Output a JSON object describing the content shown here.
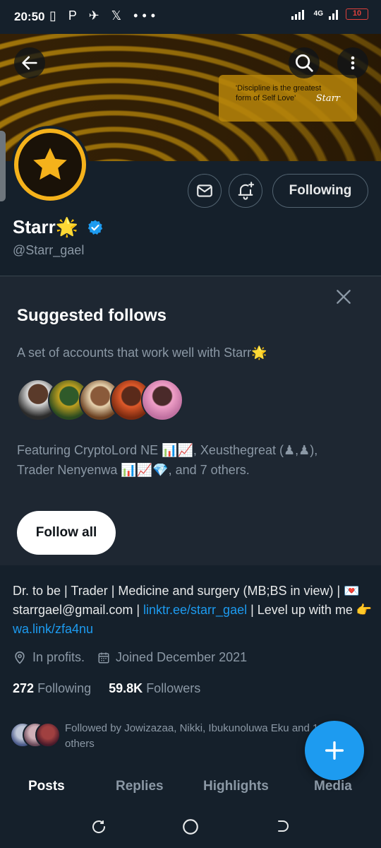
{
  "status_bar": {
    "time": "20:50",
    "notification_icons": "▯ P ✈ 𝕏 •••",
    "network": "4G",
    "battery": "10"
  },
  "banner": {
    "quote": "'Discipline is the greatest form of Self Love'",
    "signature": "Starr"
  },
  "header": {
    "back_icon": "arrow-left-icon",
    "search_icon": "search-icon",
    "more_icon": "more-vertical-icon"
  },
  "profile": {
    "name": "Starr🌟",
    "handle": "@Starr_gael",
    "following_button": "Following",
    "accent_color": "#1d9bf0"
  },
  "suggested": {
    "title": "Suggested follows",
    "subtitle": "A set of accounts that work well with Starr🌟",
    "featuring": "Featuring CryptoLord NE 📊📈, Xeusthegreat (♟,♟), Trader Nenyenwa 📊📈💎, and 7 others.",
    "follow_all": "Follow all"
  },
  "bio": {
    "text_1": "Dr. to be | Trader | Medicine and surgery (MB;BS in view) | 💌starrgael@gmail.com | ",
    "link_1": "linktr.ee/starr_gael",
    "text_2": " | Level up with me 👉 ",
    "link_2": "wa.link/zfa4nu",
    "location": "In profits.",
    "joined": "Joined December 2021"
  },
  "stats": {
    "following_count": "272",
    "following_label": "Following",
    "followers_count": "59.8K",
    "followers_label": "Followers"
  },
  "followed_by": "Followed by Jowizazaa, Nikki, Ibukunoluwa Eku and 14 others",
  "tabs": [
    "Posts",
    "Replies",
    "Highlights",
    "Media"
  ]
}
